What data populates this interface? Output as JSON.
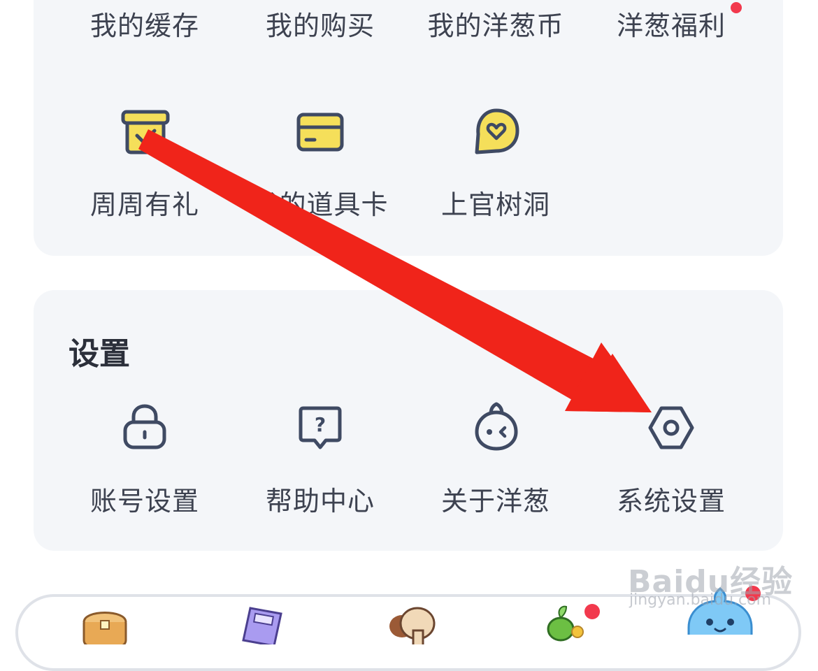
{
  "top_row": [
    "我的缓存",
    "我的购买",
    "我的洋葱币",
    "洋葱福利"
  ],
  "second_row": [
    {
      "label": "周周有礼",
      "icon": "gift-box-icon"
    },
    {
      "label": "我的道具卡",
      "icon": "card-icon"
    },
    {
      "label": "上官树洞",
      "icon": "heart-bubble-icon"
    }
  ],
  "settings": {
    "title": "设置",
    "items": [
      {
        "label": "账号设置",
        "icon": "lock-icon"
      },
      {
        "label": "帮助中心",
        "icon": "help-bubble-icon"
      },
      {
        "label": "关于洋葱",
        "icon": "onion-face-icon"
      },
      {
        "label": "系统设置",
        "icon": "hex-gear-icon"
      }
    ]
  },
  "dock_items": [
    "chest-icon",
    "book-icon",
    "mushroom-icon",
    "plant-icon",
    "onion-mascot-icon"
  ],
  "watermark": {
    "text": "Baidu经验",
    "sub": "jingyan.baidu.com"
  },
  "colors": {
    "accent_yellow": "#f5df5a",
    "outline": "#3f4a63",
    "badge": "#f2394d",
    "annotation_arrow": "#f0241a"
  }
}
